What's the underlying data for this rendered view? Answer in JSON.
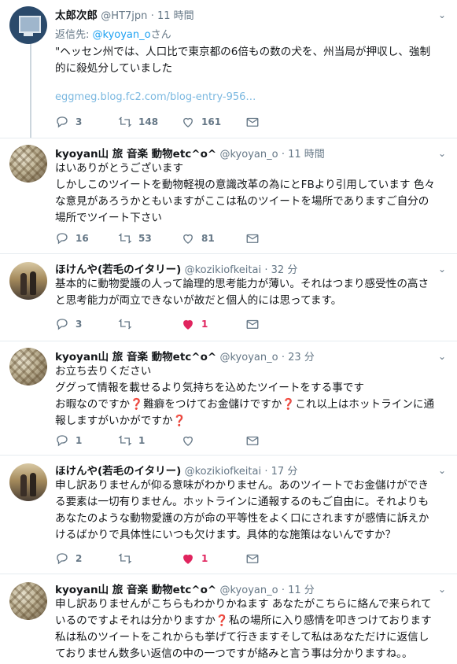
{
  "tweets": [
    {
      "name": "太郎次郎",
      "handle": "@HT7jpn",
      "time": "· 11 時間",
      "reply_prefix": "返信先: ",
      "reply_handle": "@kyoyan_o",
      "reply_suffix": "さん",
      "text": "\"ヘッセン州では、人口比で東京都の6倍もの数の犬を、州当局が押収し、強制\n的に殺処分していました",
      "link": "eggmeg.blog.fc2.com/blog-entry-956…",
      "replies": "3",
      "retweets": "148",
      "likes": "161"
    },
    {
      "name": "kyoyan山 旅 音楽 動物etc^o^",
      "handle": "@kyoyan_o",
      "time": "· 11 時間",
      "text": "はいありがとうございます\nしかしこのツイートを動物軽視の意識改革の為にとFBより引用しています 色々\nな意見があろうかともいますがここは私のツイートを場所でありますご自分の\n場所でツイート下さい",
      "replies": "16",
      "retweets": "53",
      "likes": "81"
    },
    {
      "name": "ほけんや(若毛のイタリー)",
      "handle": "@kozikiofkeitai",
      "time": "· 32 分",
      "text": "基本的に動物愛護の人って論理的思考能力が薄い。それはつまり感受性の高さ\nと思考能力が両立できないが故だと個人的には思ってます。",
      "replies": "3",
      "retweets": "",
      "likes": "1"
    },
    {
      "name": "kyoyan山 旅 音楽 動物etc^o^",
      "handle": "@kyoyan_o",
      "time": "· 23 分",
      "lines": [
        "お立ち去りください",
        "ググって情報を載せるより気持ちを込めたツイートをする事です",
        "お暇なのですか",
        "難癖をつけてお金儲けですか",
        "これ以上はホットラインに通",
        "報しますがいかがですか"
      ],
      "qmark": "❓",
      "replies": "1",
      "retweets": "1",
      "likes": ""
    },
    {
      "name": "ほけんや(若毛のイタリー)",
      "handle": "@kozikiofkeitai",
      "time": "· 17 分",
      "text": "申し訳ありませんが仰る意味がわかりません。あのツイートでお金儲けができ\nる要素は一切有りません。ホットラインに通報するのもご自由に。それよりも\nあなたのような動物愛護の方が命の平等性をよく口にされますが感情に訴えか\nけるばかりで具体性にいつも欠けます。具体的な施策はないんですか？",
      "replies": "2",
      "retweets": "",
      "likes": "1"
    },
    {
      "name": "kyoyan山 旅 音楽 動物etc^o^",
      "handle": "@kyoyan_o",
      "time": "· 11 分",
      "line1": "申し訳ありませんがこちらもわかりかねます あなたがこちらに絡んで来られて",
      "line2a": "いるのですよそれは分かりますか",
      "line2b": "私の場所に入り感情を叩きつけております",
      "line3": "私は私のツイートをこれからも挙げて行きますそして私はあなただけに返信し",
      "line4": "ておりません数多い返信の中の一つですが絡みと言う事は分かりますね。。",
      "qmark": "❓"
    }
  ],
  "colors": {
    "text": "#14171a",
    "muted": "#657786",
    "link": "#1da1f2",
    "like": "#e0245e",
    "divider": "#e6ecf0"
  },
  "icons": [
    "reply-icon",
    "retweet-icon",
    "like-icon",
    "message-icon",
    "chevron-down-icon"
  ]
}
